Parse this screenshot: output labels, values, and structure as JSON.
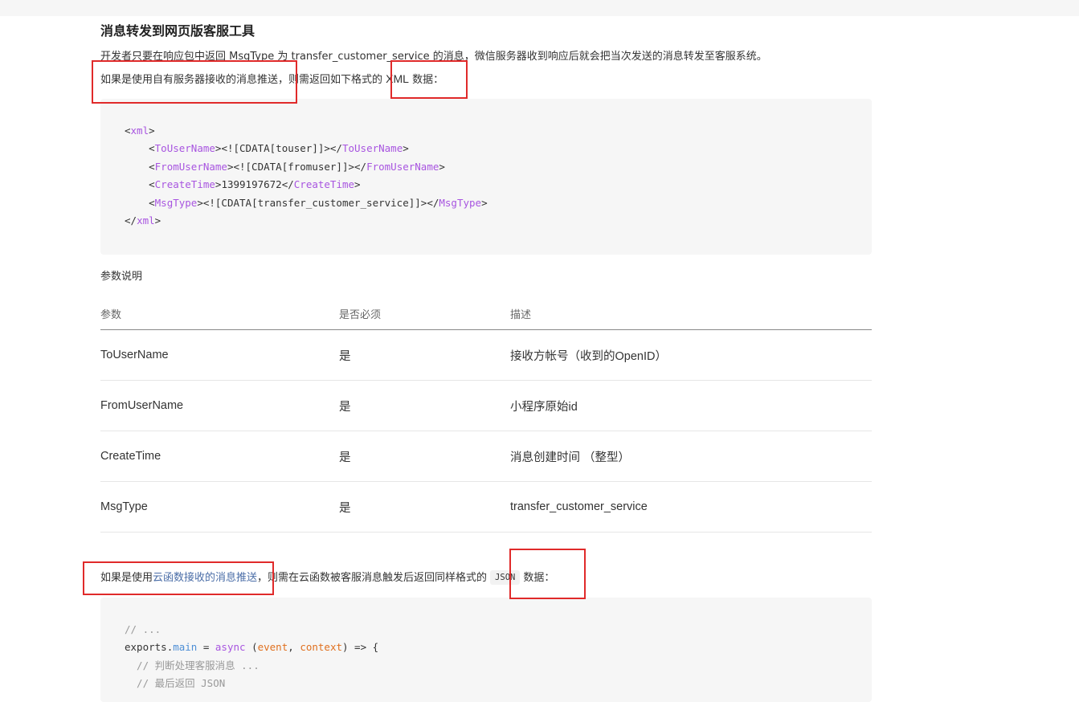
{
  "section_title": "消息转发到网页版客服工具",
  "intro": "开发者只要在响应包中返回 MsgType 为 transfer_customer_service 的消息，微信服务器收到响应后就会把当次发送的消息转发至客服系统。",
  "server_push": {
    "prefix": "如果是使用自有服务器接收的消息推送，则需返回如下格式的 ",
    "format": "XML",
    "suffix": " 数据："
  },
  "xml_code": {
    "open_tag": "xml",
    "fields": [
      {
        "tag": "ToUserName",
        "value": "<![CDATA[touser]]>"
      },
      {
        "tag": "FromUserName",
        "value": "<![CDATA[fromuser]]>"
      },
      {
        "tag": "CreateTime",
        "value": "1399197672"
      },
      {
        "tag": "MsgType",
        "value": "<![CDATA[transfer_customer_service]]>"
      }
    ]
  },
  "params_label": "参数说明",
  "params_table": {
    "headers": [
      "参数",
      "是否必须",
      "描述"
    ],
    "rows": [
      [
        "ToUserName",
        "是",
        "接收方帐号（收到的OpenID）"
      ],
      [
        "FromUserName",
        "是",
        "小程序原始id"
      ],
      [
        "CreateTime",
        "是",
        "消息创建时间 （整型）"
      ],
      [
        "MsgType",
        "是",
        "transfer_customer_service"
      ]
    ]
  },
  "cloud_push": {
    "prefix": "如果是使用",
    "link": "云函数接收的消息推送",
    "middle": "，则需在云函数被客服消息触发后返回同样格式的",
    "format": "JSON",
    "suffix": "数据："
  },
  "js_code": {
    "line1": "// ...",
    "exports": "exports",
    "dot": ".",
    "main": "main",
    "eq": " = ",
    "async": "async",
    "open_paren": " (",
    "event": "event",
    "comma": ", ",
    "context": "context",
    "arrow": ") => {",
    "comment1": "  // 判断处理客服消息 ...",
    "comment2": "  // 最后返回 JSON"
  },
  "colors": {
    "highlight_box": "#e02a2a",
    "tag_name": "#a855e0",
    "link": "#4a6da7"
  }
}
